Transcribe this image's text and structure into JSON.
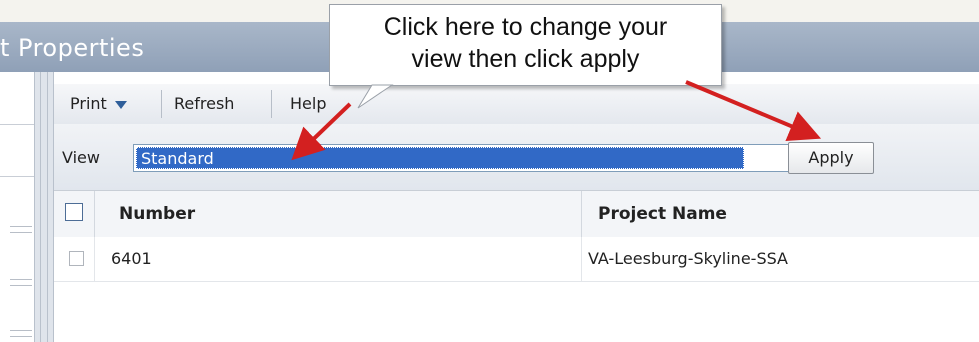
{
  "window": {
    "title": "t Properties"
  },
  "toolbar": {
    "print_label": "Print",
    "refresh_label": "Refresh",
    "help_label": "Help"
  },
  "view": {
    "label": "View",
    "selected": "Standard",
    "apply_label": "Apply"
  },
  "grid": {
    "columns": [
      "Number",
      "Project Name"
    ],
    "rows": [
      {
        "number": "6401",
        "project_name": "VA-Leesburg-Skyline-SSA"
      }
    ]
  },
  "callout": {
    "line1": "Click here to change your",
    "line2": "view then click apply"
  },
  "colors": {
    "title_bar": "#9aa9bd",
    "selection": "#3169c6",
    "arrow": "#d32020"
  }
}
